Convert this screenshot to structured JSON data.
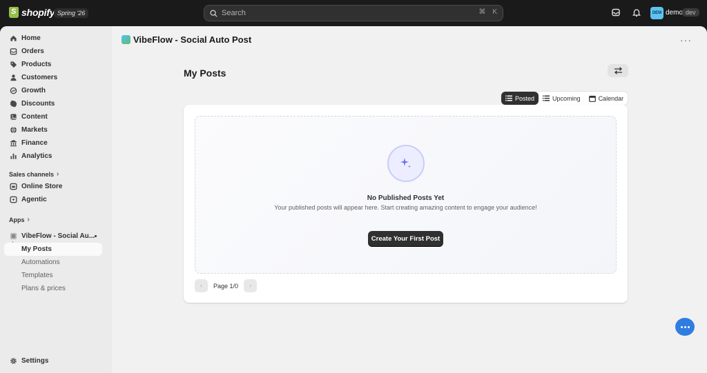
{
  "topbar": {
    "brand": "shopify",
    "season": "Spring '26",
    "search_placeholder": "Search",
    "shortcut_cmd": "⌘",
    "shortcut_key": "K",
    "avatar_initials": "DEM",
    "user_name": "demo",
    "store_badge": "dev"
  },
  "sidebar": {
    "items": [
      {
        "label": "Home",
        "icon": "home-icon"
      },
      {
        "label": "Orders",
        "icon": "orders-icon"
      },
      {
        "label": "Products",
        "icon": "tag-icon"
      },
      {
        "label": "Customers",
        "icon": "person-icon"
      },
      {
        "label": "Growth",
        "icon": "growth-icon"
      },
      {
        "label": "Discounts",
        "icon": "discount-icon"
      },
      {
        "label": "Content",
        "icon": "content-icon"
      },
      {
        "label": "Markets",
        "icon": "globe-icon"
      },
      {
        "label": "Finance",
        "icon": "bank-icon"
      },
      {
        "label": "Analytics",
        "icon": "chart-bar-icon"
      }
    ],
    "sales_channels_label": "Sales channels",
    "channels": [
      {
        "label": "Online Store",
        "icon": "store-icon"
      },
      {
        "label": "Agentic",
        "icon": "agent-icon"
      }
    ],
    "apps_label": "Apps",
    "app_name": "VibeFlow - Social Au...",
    "app_subitems": [
      {
        "label": "My Posts",
        "active": true
      },
      {
        "label": "Automations",
        "active": false
      },
      {
        "label": "Templates",
        "active": false
      },
      {
        "label": "Plans & prices",
        "active": false
      }
    ],
    "settings_label": "Settings"
  },
  "main": {
    "app_title": "VibeFlow - Social Auto Post",
    "page_title": "My Posts",
    "tabs": [
      {
        "label": "Posted",
        "active": true
      },
      {
        "label": "Upcoming",
        "active": false
      },
      {
        "label": "Calendar",
        "active": false
      }
    ],
    "empty_title": "No Published Posts Yet",
    "empty_desc": "Your published posts will appear here. Start creating amazing content to engage your audience!",
    "cta_label": "Create Your First Post",
    "pagination": "Page 1/0"
  },
  "colors": {
    "topbar_bg": "#1a1a1a",
    "frame_bg": "#f1f1f1",
    "sidebar_bg": "#ebebeb",
    "primary_button": "#303030",
    "accent_purple": "#6b6ff0",
    "chat_blue": "#2f7de1"
  }
}
